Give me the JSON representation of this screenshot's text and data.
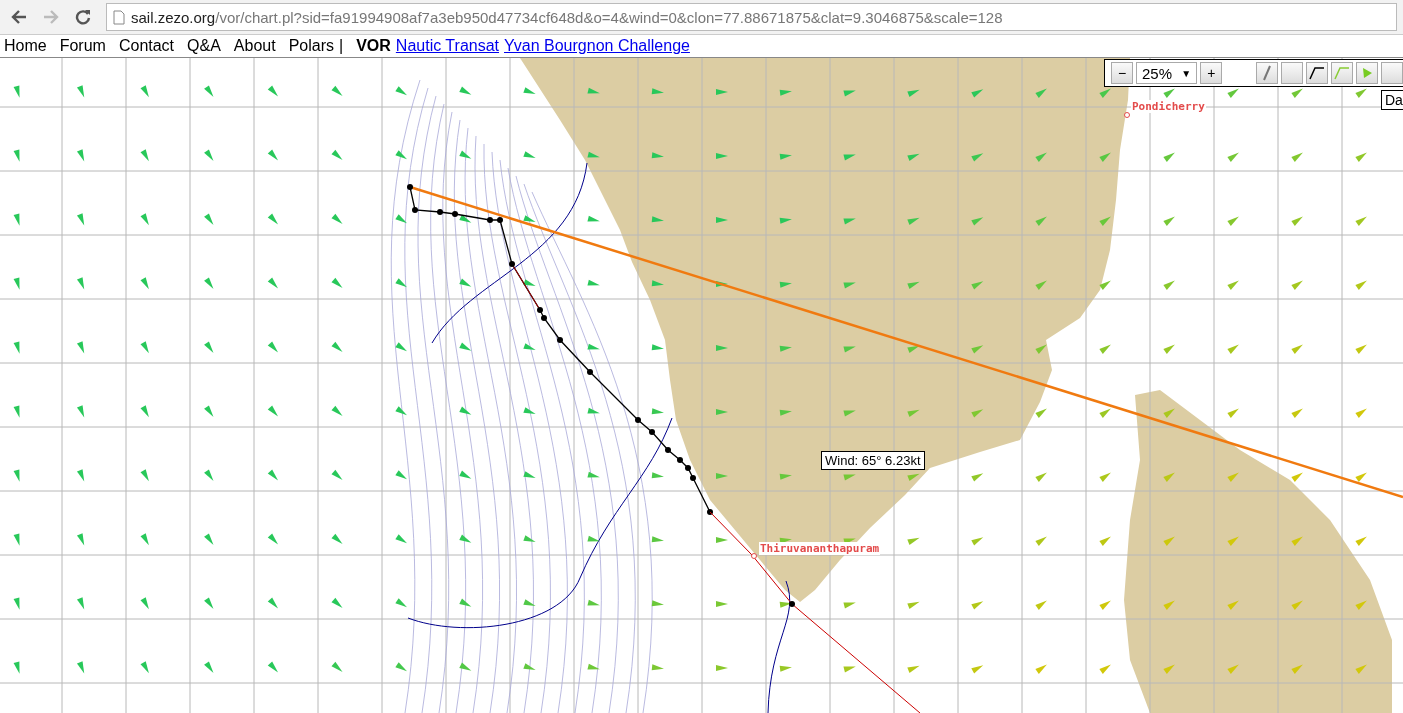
{
  "browser": {
    "url_host": "sail.zezo.org",
    "url_path": "/vor/chart.pl?sid=fa91994908af7a3eb950d47734cf648d&o=4&wind=0&clon=77.88671875&clat=9.3046875&scale=128"
  },
  "nav": [
    {
      "label": "Home",
      "kind": "plain"
    },
    {
      "label": "Forum",
      "kind": "plain"
    },
    {
      "label": "Contact",
      "kind": "plain"
    },
    {
      "label": "Q&A",
      "kind": "plain"
    },
    {
      "label": "About",
      "kind": "plain"
    },
    {
      "label": "Polars",
      "kind": "plain"
    },
    {
      "label": "|",
      "kind": "separator"
    },
    {
      "label": "VOR",
      "kind": "bold"
    },
    {
      "label": "Nautic Transat",
      "kind": "link"
    },
    {
      "label": "Yvan Bourgnon Challenge",
      "kind": "link"
    }
  ],
  "toolbar": {
    "zoom_out": "−",
    "zoom_value": "25%",
    "dropdown_arrow": "▼",
    "zoom_in": "+",
    "tools": [
      {
        "kind": "pencil",
        "selected": false
      },
      {
        "kind": "blank",
        "selected": false
      },
      {
        "kind": "line",
        "selected": false
      },
      {
        "kind": "line-green",
        "selected": false
      },
      {
        "kind": "arrow",
        "selected": false
      },
      {
        "kind": "blank",
        "selected": false
      }
    ],
    "tooltip": "Da"
  },
  "map": {
    "cities": [
      {
        "name": "Pondicherry",
        "kind": "top-right"
      },
      {
        "name": "Thiruvananthapuram",
        "kind": "right"
      }
    ],
    "wind_tooltip": "Wind: 65° 6.23kt"
  }
}
